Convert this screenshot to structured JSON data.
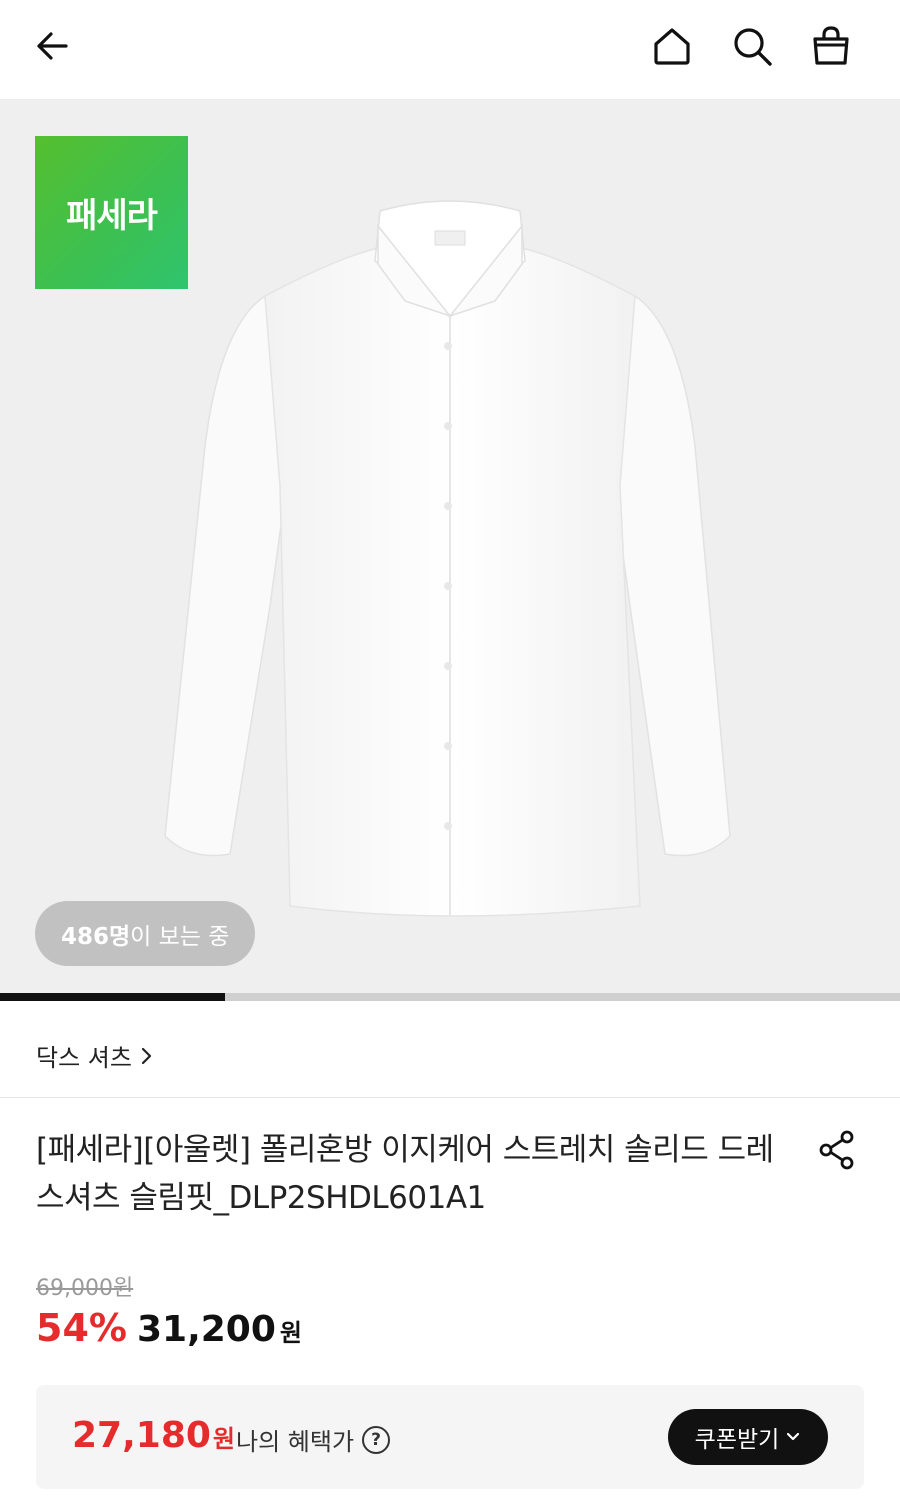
{
  "header": {
    "back_icon": "arrow-left-icon",
    "home_icon": "home-icon",
    "search_icon": "search-icon",
    "cart_icon": "shopping-bag-icon"
  },
  "hero": {
    "brand_badge": "패세라",
    "viewer_count": "486명",
    "viewer_suffix": "이 보는 중",
    "image_progress": 0.25
  },
  "brand": {
    "label": "닥스 셔츠"
  },
  "product": {
    "title": "[패세라][아울렛] 폴리혼방 이지케어 스트레치 솔리드 드레스셔츠 슬림핏_DLP2SHDL601A1",
    "original_price": "69,000원",
    "discount_rate": "54%",
    "sale_price": "31,200",
    "sale_price_unit": "원"
  },
  "benefit": {
    "price": "27,180",
    "price_unit": "원",
    "label": "나의 혜택가",
    "help_symbol": "?",
    "coupon_button": "쿠폰받기"
  },
  "colors": {
    "accent_red": "#e52b2b",
    "brand_green": "#3dc050",
    "button_dark": "#111111"
  }
}
